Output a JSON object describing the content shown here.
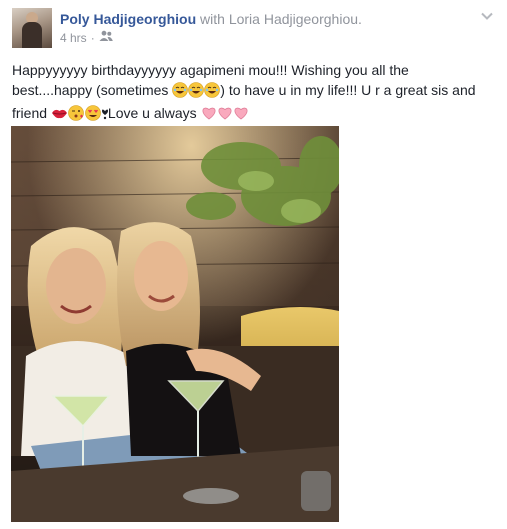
{
  "post": {
    "author": "Poly Hadjigeorghiou",
    "with_word": "with",
    "tagged": "Loria Hadjigeorghiou.",
    "time": "4 hrs",
    "separator": "·",
    "privacy_icon": "friends-icon",
    "menu_icon": "chevron-down-icon",
    "text": {
      "line1": "Happyyyyyy birthdayyyyyy agapimeni mou!!! Wishing you all the",
      "line2_a": "best....happy (sometimes ",
      "line2_b": ") to have u in my life!!! U r a great sis and",
      "line3_a": "friend ",
      "line3_b": "Love u always "
    },
    "emojis": {
      "laughing": "grinning-sweat-emoji",
      "kiss": "lips-emoji",
      "wink": "wink-kiss-emoji",
      "heart_eyes": "heart-eyes-emoji",
      "heart": "pink-heart-emoji"
    },
    "photo": {
      "icon": "photo-of-two-women-with-martinis"
    }
  },
  "colors": {
    "author": "#365899",
    "meta": "#90949c",
    "text": "#1d2129"
  }
}
